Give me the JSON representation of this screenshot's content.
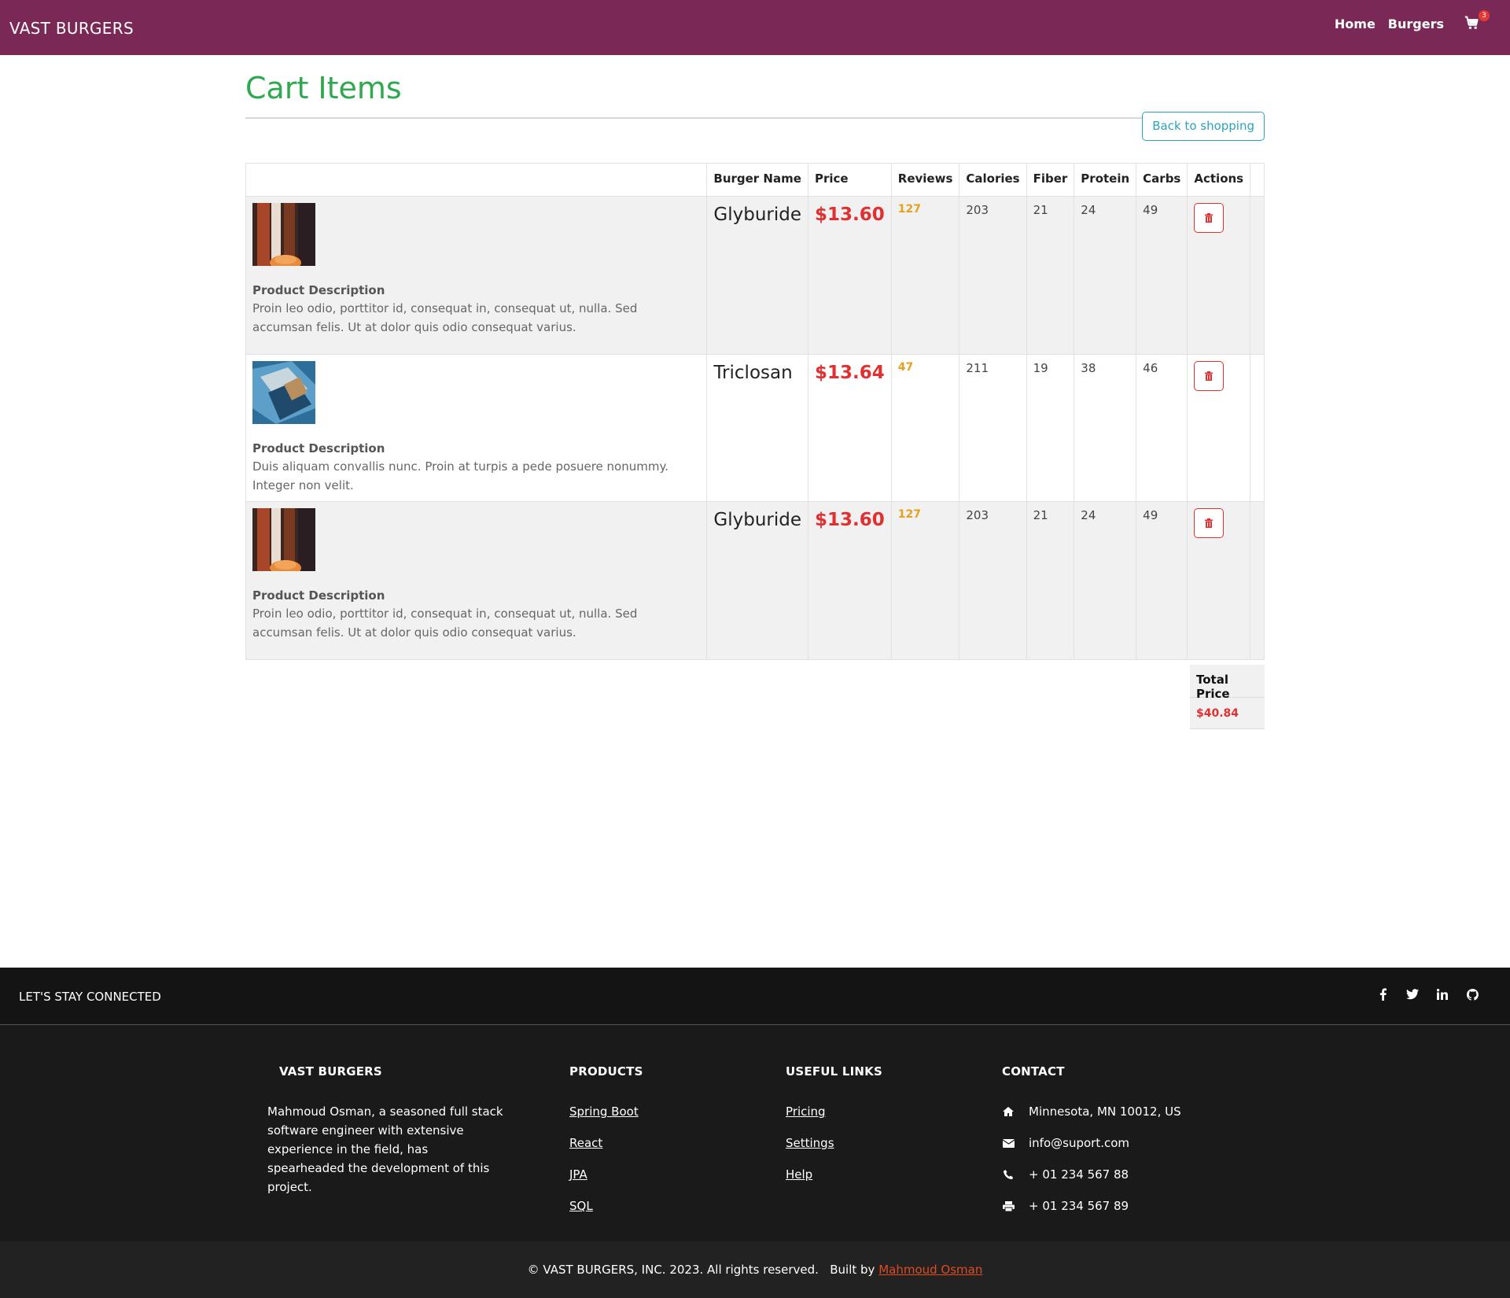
{
  "nav": {
    "brand": "VAST BURGERS",
    "links": [
      "Home",
      "Burgers"
    ],
    "cart_count": "3"
  },
  "page": {
    "title": "Cart Items",
    "back_button": "Back to shopping"
  },
  "table": {
    "headers": [
      "",
      "Burger Name",
      "Price",
      "Reviews",
      "Calories",
      "Fiber",
      "Protein",
      "Carbs",
      "Actions"
    ],
    "rows": [
      {
        "desc_heading": "Product Description",
        "description": "Proin leo odio, porttitor id, consequat in, consequat ut, nulla. Sed accumsan felis. Ut at dolor quis odio consequat varius.",
        "name": "Glyburide",
        "price": "$13.60",
        "reviews": "127",
        "calories": "203",
        "fiber": "21",
        "protein": "24",
        "carbs": "49"
      },
      {
        "desc_heading": "Product Description",
        "description": "Duis aliquam convallis nunc. Proin at turpis a pede posuere nonummy. Integer non velit.",
        "name": "Triclosan",
        "price": "$13.64",
        "reviews": "47",
        "calories": "211",
        "fiber": "19",
        "protein": "38",
        "carbs": "46"
      },
      {
        "desc_heading": "Product Description",
        "description": "Proin leo odio, porttitor id, consequat in, consequat ut, nulla. Sed accumsan felis. Ut at dolor quis odio consequat varius.",
        "name": "Glyburide",
        "price": "$13.60",
        "reviews": "127",
        "calories": "203",
        "fiber": "21",
        "protein": "24",
        "carbs": "49"
      }
    ]
  },
  "total": {
    "label": "Total Price",
    "value": "$40.84"
  },
  "footer": {
    "stay_connected": "LET'S STAY CONNECTED",
    "social_icons": [
      "facebook-icon",
      "twitter-icon",
      "linkedin-icon",
      "github-icon"
    ],
    "about": {
      "heading": "VAST BURGERS",
      "text": "Mahmoud Osman, a seasoned full stack software engineer with extensive experience in the field, has spearheaded the development of this project."
    },
    "products": {
      "heading": "PRODUCTS",
      "links": [
        "Spring Boot",
        "React",
        "JPA",
        "SQL"
      ]
    },
    "useful": {
      "heading": "USEFUL LINKS",
      "links": [
        "Pricing",
        "Settings",
        "Help"
      ]
    },
    "contact": {
      "heading": "CONTACT",
      "address": "Minnesota, MN 10012, US",
      "email": "info@suport.com",
      "phone": "+ 01 234 567 88",
      "fax": "+ 01 234 567 89"
    },
    "copyright": "© VAST BURGERS, INC. 2023. All rights reserved.",
    "built_by": "Built by",
    "author": "Mahmoud Osman"
  },
  "colors": {
    "navbar": "#7a2956",
    "title_green": "#2fa84f",
    "price_red": "#e03030",
    "reviews_orange": "#e6a020",
    "back_button_blue": "#2ba3bf",
    "footer_dark": "#1a1a1a",
    "author_link": "#e24a1f"
  }
}
